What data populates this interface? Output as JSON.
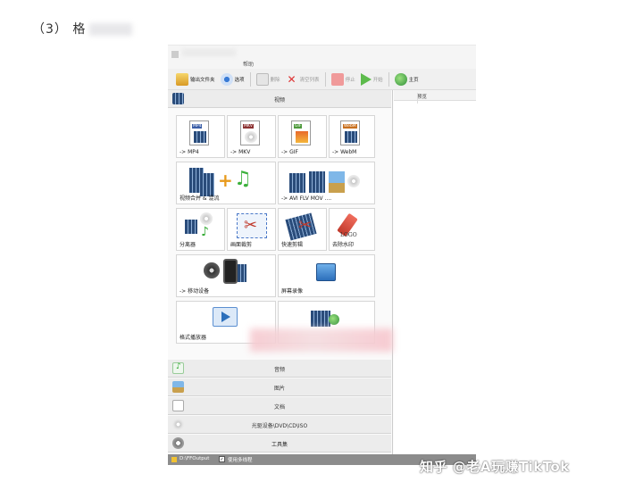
{
  "doc_heading": {
    "number": "（3）",
    "text": "格"
  },
  "window": {
    "title": "帮助",
    "toolbar": [
      {
        "name": "output-folder-button",
        "label": "输出文件夹",
        "icon": "folder-icon",
        "enabled": true
      },
      {
        "name": "options-button",
        "label": "选项",
        "icon": "eye-icon",
        "enabled": true
      },
      {
        "name": "delete-button",
        "label": "删除",
        "icon": "document-icon",
        "enabled": false
      },
      {
        "name": "clear-list-button",
        "label": "清空列表",
        "icon": "close-icon",
        "enabled": false
      },
      {
        "name": "stop-button",
        "label": "停止",
        "icon": "stop-icon",
        "enabled": false
      },
      {
        "name": "start-button",
        "label": "开始",
        "icon": "play-icon",
        "enabled": false
      },
      {
        "name": "home-button",
        "label": "主页",
        "icon": "globe-icon",
        "enabled": true
      }
    ],
    "video_category": "视频",
    "tiles": [
      {
        "name": "tile-mp4",
        "label": "-> MP4",
        "tag": "MP4",
        "tag_color": "#3c5fa8"
      },
      {
        "name": "tile-mkv",
        "label": "-> MKV",
        "tag": "MKV",
        "tag_color": "#8c3232"
      },
      {
        "name": "tile-gif",
        "label": "-> GIF",
        "tag": "GIF",
        "tag_color": "#4f9a3d"
      },
      {
        "name": "tile-webm",
        "label": "-> WebM",
        "tag": "WebM",
        "tag_color": "#c8701f"
      },
      {
        "name": "tile-merge",
        "label": "视频合并 & 混流"
      },
      {
        "name": "tile-multiformat",
        "label": "-> AVI FLV MOV ...."
      },
      {
        "name": "tile-splitter",
        "label": "分离器"
      },
      {
        "name": "tile-crop",
        "label": "画面裁剪"
      },
      {
        "name": "tile-quickcut",
        "label": "快速剪辑"
      },
      {
        "name": "tile-remove-logo",
        "label": "去除水印",
        "logo_text": "LOGO"
      },
      {
        "name": "tile-mobile",
        "label": "-> 移动设备"
      },
      {
        "name": "tile-screen-record",
        "label": "屏幕录像"
      },
      {
        "name": "tile-player",
        "label": "格式播放器"
      },
      {
        "name": "tile-extra",
        "label": ""
      }
    ],
    "categories": [
      {
        "name": "category-audio",
        "label": "音频",
        "icon": "music-icon"
      },
      {
        "name": "category-image",
        "label": "图片",
        "icon": "picture-icon"
      },
      {
        "name": "category-document",
        "label": "文档",
        "icon": "document-icon"
      },
      {
        "name": "category-disc",
        "label": "光驱设备\\DVD\\CD\\ISO",
        "icon": "disc-icon"
      },
      {
        "name": "category-tools",
        "label": "工具集",
        "icon": "gear-icon"
      }
    ],
    "right_column_header": "预览",
    "statusbar": {
      "output_path": "D:\\FFOutput",
      "checkbox_label": "使用多线程",
      "checked": true
    }
  },
  "watermark": "知乎 @老A玩赚TikTok"
}
